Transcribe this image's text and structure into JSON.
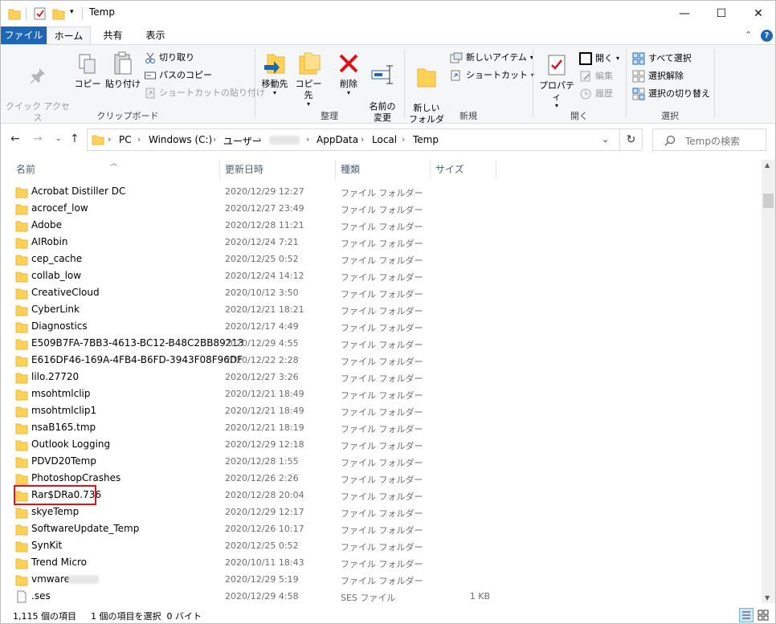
{
  "window": {
    "title": "Temp",
    "controls": {
      "minimize": "—",
      "maximize": "☐",
      "close": "✕"
    }
  },
  "ribbon_tabs": {
    "file": "ファイル",
    "home": "ホーム",
    "share": "共有",
    "view": "表示"
  },
  "ribbon": {
    "clipboard": {
      "group_label": "クリップボード",
      "pin_quick_access": "クイック アクセス\nにピン留めする",
      "copy": "コピー",
      "paste": "貼り付け",
      "cut": "切り取り",
      "copy_path": "パスのコピー",
      "paste_shortcut": "ショートカットの貼り付け"
    },
    "organize": {
      "group_label": "整理",
      "move_to": "移動先",
      "copy_to": "コピー先",
      "delete": "削除",
      "rename": "名前の\n変更"
    },
    "new": {
      "group_label": "新規",
      "new_folder": "新しい\nフォルダー",
      "new_item": "新しいアイテム",
      "easy_access": "ショートカット"
    },
    "open": {
      "group_label": "開く",
      "properties": "プロパティ",
      "open": "開く",
      "edit": "編集",
      "history": "履歴"
    },
    "select": {
      "group_label": "選択",
      "select_all": "すべて選択",
      "select_none": "選択解除",
      "invert": "選択の切り替え"
    }
  },
  "address": {
    "breadcrumbs": [
      "PC",
      "Windows (C:)",
      "ユーザー",
      "",
      "AppData",
      "Local",
      "Temp"
    ],
    "search_placeholder": "Tempの検索"
  },
  "columns": {
    "name": "名前",
    "modified": "更新日時",
    "type": "種類",
    "size": "サイズ"
  },
  "files": [
    {
      "name": "Acrobat Distiller DC",
      "modified": "2020/12/29 12:27",
      "type": "ファイル フォルダー",
      "size": "",
      "kind": "folder"
    },
    {
      "name": "acrocef_low",
      "modified": "2020/12/27 23:49",
      "type": "ファイル フォルダー",
      "size": "",
      "kind": "folder"
    },
    {
      "name": "Adobe",
      "modified": "2020/12/28 11:21",
      "type": "ファイル フォルダー",
      "size": "",
      "kind": "folder"
    },
    {
      "name": "AIRobin",
      "modified": "2020/12/24 7:21",
      "type": "ファイル フォルダー",
      "size": "",
      "kind": "folder"
    },
    {
      "name": "cep_cache",
      "modified": "2020/12/25 0:52",
      "type": "ファイル フォルダー",
      "size": "",
      "kind": "folder"
    },
    {
      "name": "collab_low",
      "modified": "2020/12/24 14:12",
      "type": "ファイル フォルダー",
      "size": "",
      "kind": "folder"
    },
    {
      "name": "CreativeCloud",
      "modified": "2020/10/12 3:50",
      "type": "ファイル フォルダー",
      "size": "",
      "kind": "folder"
    },
    {
      "name": "CyberLink",
      "modified": "2020/12/21 18:21",
      "type": "ファイル フォルダー",
      "size": "",
      "kind": "folder"
    },
    {
      "name": "Diagnostics",
      "modified": "2020/12/17 4:49",
      "type": "ファイル フォルダー",
      "size": "",
      "kind": "folder"
    },
    {
      "name": "E509B7FA-7BB3-4613-BC12-B48C2BB89213",
      "modified": "2020/12/29 4:55",
      "type": "ファイル フォルダー",
      "size": "",
      "kind": "folder"
    },
    {
      "name": "E616DF46-169A-4FB4-B6FD-3943F08F96DF",
      "modified": "2020/12/22 2:28",
      "type": "ファイル フォルダー",
      "size": "",
      "kind": "folder"
    },
    {
      "name": "lilo.27720",
      "modified": "2020/12/27 3:26",
      "type": "ファイル フォルダー",
      "size": "",
      "kind": "folder"
    },
    {
      "name": "msohtmlclip",
      "modified": "2020/12/21 18:49",
      "type": "ファイル フォルダー",
      "size": "",
      "kind": "folder"
    },
    {
      "name": "msohtmlclip1",
      "modified": "2020/12/21 18:49",
      "type": "ファイル フォルダー",
      "size": "",
      "kind": "folder"
    },
    {
      "name": "nsaB165.tmp",
      "modified": "2020/12/21 18:19",
      "type": "ファイル フォルダー",
      "size": "",
      "kind": "folder"
    },
    {
      "name": "Outlook Logging",
      "modified": "2020/12/29 12:18",
      "type": "ファイル フォルダー",
      "size": "",
      "kind": "folder"
    },
    {
      "name": "PDVD20Temp",
      "modified": "2020/12/28 1:55",
      "type": "ファイル フォルダー",
      "size": "",
      "kind": "folder"
    },
    {
      "name": "PhotoshopCrashes",
      "modified": "2020/12/26 2:26",
      "type": "ファイル フォルダー",
      "size": "",
      "kind": "folder"
    },
    {
      "name": "Rar$DRa0.736",
      "modified": "2020/12/28 20:04",
      "type": "ファイル フォルダー",
      "size": "",
      "kind": "folder",
      "highlighted": true
    },
    {
      "name": "skyeTemp",
      "modified": "2020/12/29 12:17",
      "type": "ファイル フォルダー",
      "size": "",
      "kind": "folder"
    },
    {
      "name": "SoftwareUpdate_Temp",
      "modified": "2020/12/26 10:17",
      "type": "ファイル フォルダー",
      "size": "",
      "kind": "folder"
    },
    {
      "name": "SynKit",
      "modified": "2020/12/25 0:52",
      "type": "ファイル フォルダー",
      "size": "",
      "kind": "folder"
    },
    {
      "name": "Trend Micro",
      "modified": "2020/10/11 18:43",
      "type": "ファイル フォルダー",
      "size": "",
      "kind": "folder"
    },
    {
      "name": "vmware-",
      "modified": "2020/12/29 5:19",
      "type": "ファイル フォルダー",
      "size": "",
      "kind": "folder",
      "redacted_suffix": true
    },
    {
      "name": ".ses",
      "modified": "2020/12/29 4:58",
      "type": "SES ファイル",
      "size": "1 KB",
      "kind": "file"
    }
  ],
  "status": {
    "item_count": "1,115 個の項目",
    "selection": "1 個の項目を選択  0 バイト"
  },
  "colors": {
    "file_tab": "#1e67b6",
    "folder": "#ffd256",
    "folder_dark": "#e8b43c",
    "highlight_box": "#e0111f",
    "delete_red": "#e0111f"
  }
}
